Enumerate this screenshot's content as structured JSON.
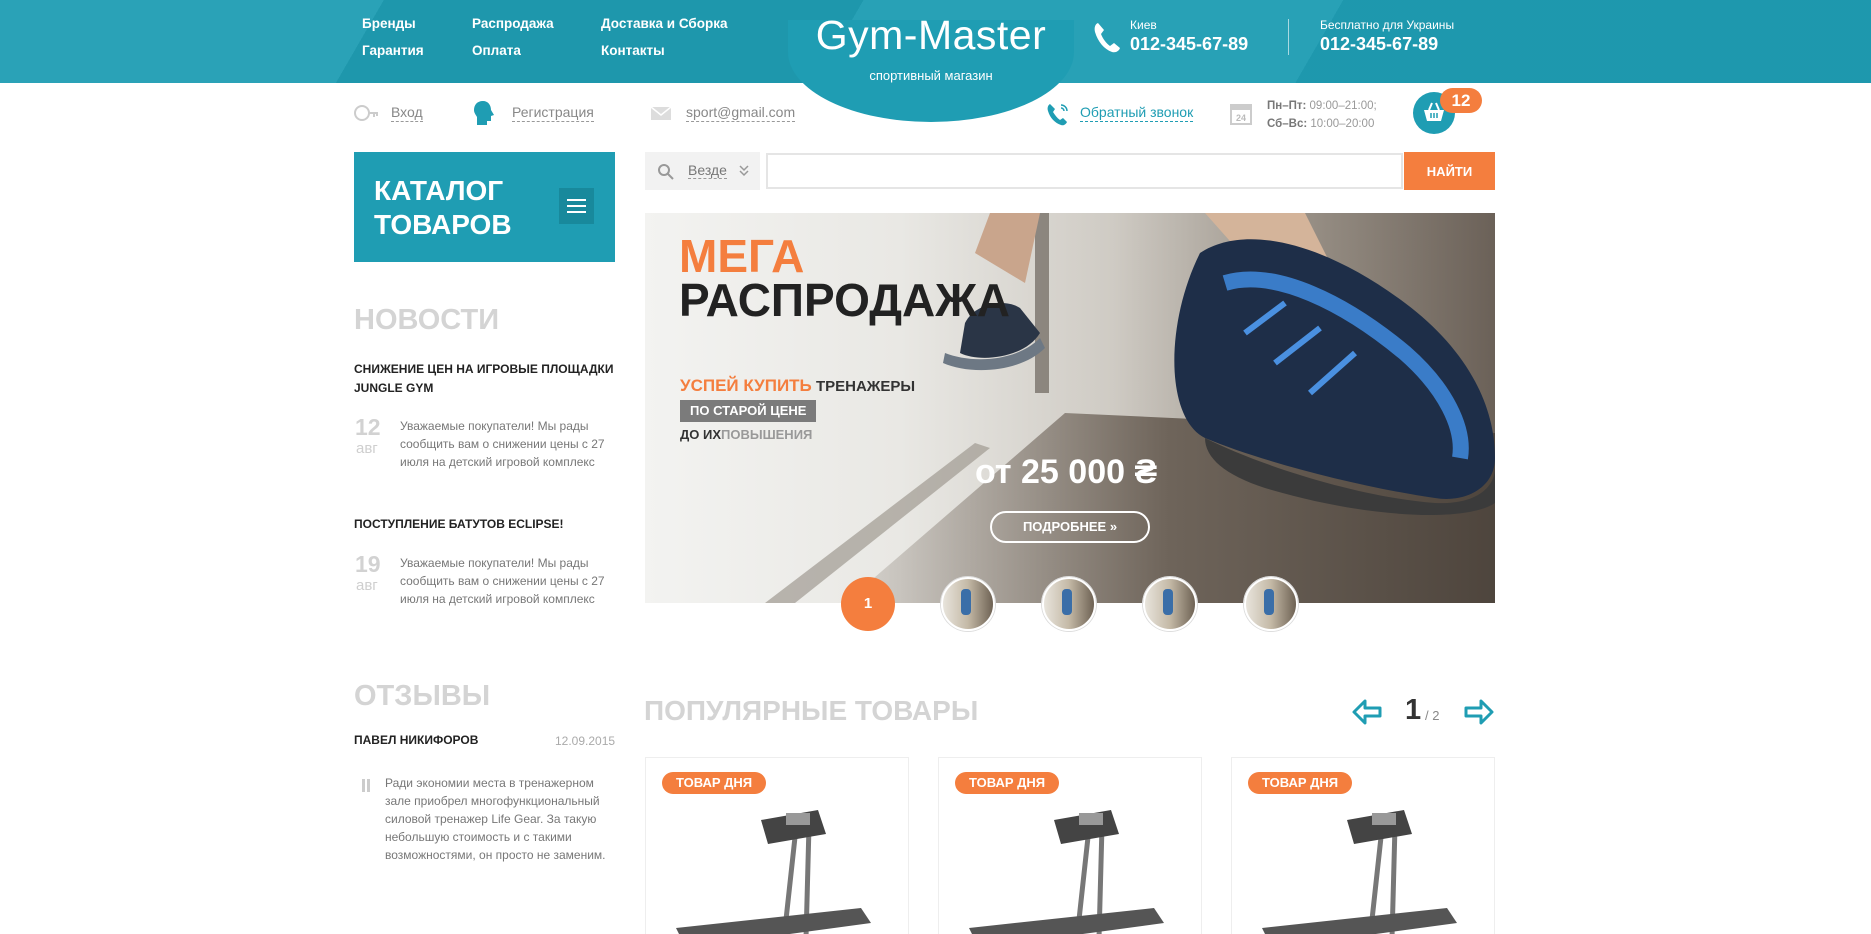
{
  "header": {
    "nav": [
      "Бренды",
      "Распродажа",
      "Доставка и Сборка",
      "Гарантия",
      "Оплата",
      "Контакты"
    ],
    "logo_title": "Gym-Master",
    "logo_subtitle": "спортивный магазин",
    "city": "Киев",
    "phone": "012-345-67-89",
    "free_label": "Бесплатно для Украины",
    "free_phone": "012-345-67-89"
  },
  "subbar": {
    "login": "Вход",
    "register": "Регистрация",
    "email": "sport@gmail.com",
    "callback": "Обратный звонок",
    "hours_weekday_label": "Пн–Пт:",
    "hours_weekday": " 09:00–21:00;",
    "hours_weekend_label": "Сб–Вс:",
    "hours_weekend": " 10:00–20:00",
    "cart_count": "12"
  },
  "catalog": {
    "title_line1": "КАТАЛОГ",
    "title_line2": "ТОВАРОВ"
  },
  "search": {
    "scope": "Везде",
    "value": "",
    "button": "НАЙТИ"
  },
  "news": {
    "title": "НОВОСТИ",
    "items": [
      {
        "headline": "СНИЖЕНИЕ ЦЕН НА ИГРОВЫЕ ПЛОЩАДКИ JUNGLE GYM",
        "day": "12",
        "month": "авг",
        "text": "Уважаемые покупатели! Мы рады сообщить вам о снижении цены с 27 июля на детский игровой комплекс"
      },
      {
        "headline": "ПОСТУПЛЕНИЕ БАТУТОВ ECLIPSE!",
        "day": "19",
        "month": "авг",
        "text": "Уважаемые покупатели! Мы рады сообщить вам о снижении цены с 27 июля на детский игровой комплекс"
      }
    ]
  },
  "reviews": {
    "title": "ОТЗЫВЫ",
    "author": "ПАВЕЛ НИКИФОРОВ",
    "date": "12.09.2015",
    "text": "Ради экономии места в тренажерном зале приобрел многофункциональный силовой тренажер Life Gear. За такую небольшую стоимость и с такими возможностями, он просто не заменим."
  },
  "banner": {
    "mega": "МЕГА",
    "sale": "РАСПРОДАЖА",
    "hurry": "УСПЕЙ КУПИТЬ",
    "hurry_rest": " ТРЕНАЖЕРЫ",
    "old_price_box": "ПО СТАРОЙ ЦЕНЕ",
    "until": "ДО ИХ",
    "until_grey": "ПОВЫШЕНИЯ",
    "price": "от 25 000 ₴",
    "more": "ПОДРОБНЕЕ",
    "active_slide": "1"
  },
  "popular": {
    "title": "ПОПУЛЯРНЫЕ ТОВАРЫ",
    "page": "1",
    "pages": "/ 2",
    "badge": "ТОВАР ДНЯ"
  },
  "colors": {
    "teal": "#1f9db3",
    "orange": "#f47e3e"
  }
}
